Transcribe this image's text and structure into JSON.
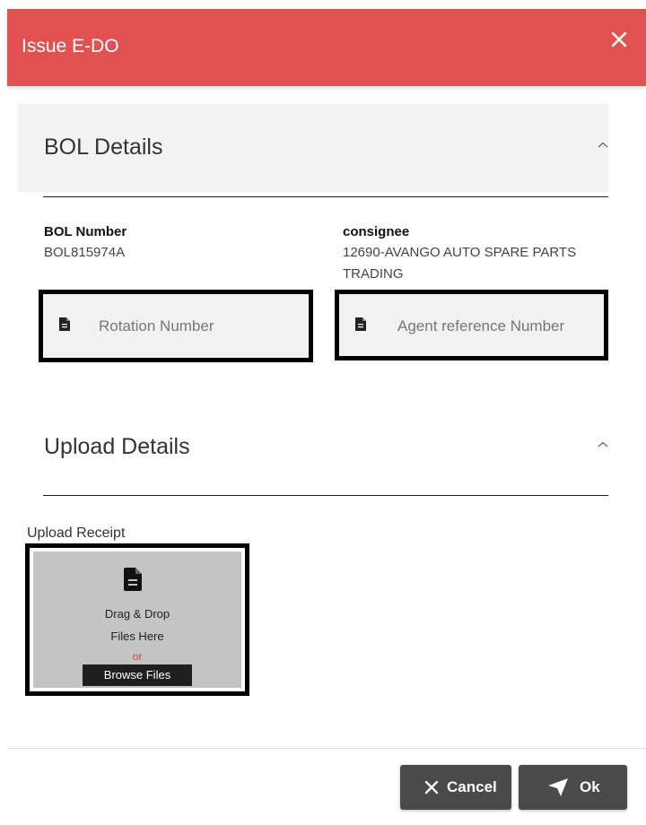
{
  "dialog": {
    "title": "Issue E-DO",
    "close_icon": "close-icon"
  },
  "bol_section": {
    "title": "BOL Details",
    "bol_number_label": "BOL Number",
    "bol_number_value": "BOL815974A",
    "consignee_label": "consignee",
    "consignee_value_line1": "12690-AVANGO AUTO SPARE PARTS",
    "consignee_value_line2": "TRADING",
    "rotation_placeholder": "Rotation Number",
    "agent_ref_placeholder": "Agent reference Number"
  },
  "upload_section": {
    "title": "Upload Details",
    "receipt_label": "Upload Receipt",
    "drop_line1": "Drag & Drop",
    "drop_line2": "Files Here",
    "or_text": "or",
    "browse_label": "Browse Files"
  },
  "footer": {
    "cancel_label": "Cancel",
    "ok_label": "Ok"
  },
  "colors": {
    "header_bg": "#e05150",
    "button_bg": "#4a4a4a",
    "or_text": "#e53935"
  }
}
